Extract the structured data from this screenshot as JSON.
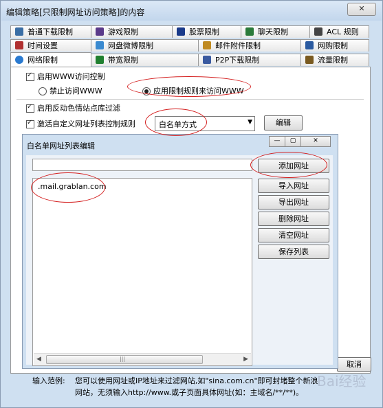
{
  "window": {
    "title": "编辑策略[只限制网址访问策略]的内容",
    "close_symbol": "✕"
  },
  "tabs_row1": [
    {
      "label": "普通下载限制",
      "icon": "download-clock-icon",
      "color": "#3a6ea5"
    },
    {
      "label": "游戏限制",
      "icon": "game-icon",
      "color": "#5a3a8a"
    },
    {
      "label": "股票限制",
      "icon": "stock-icon",
      "color": "#1a3a8a"
    },
    {
      "label": "聊天限制",
      "icon": "chat-icon",
      "color": "#2a7a3a"
    },
    {
      "label": "ACL 规则",
      "icon": "acl-icon",
      "color": "#444444"
    }
  ],
  "tabs_row2": [
    {
      "label": "时间设置",
      "icon": "clock-icon",
      "color": "#b03030"
    },
    {
      "label": "网盘微博限制",
      "icon": "cloud-icon",
      "color": "#3a8ad0"
    },
    {
      "label": "邮件附件限制",
      "icon": "mail-icon",
      "color": "#c08a20"
    },
    {
      "label": "网购限制",
      "icon": "cart-icon",
      "color": "#2a5aa0"
    }
  ],
  "tabs_row3": [
    {
      "label": "网络限制",
      "icon": "globe-icon",
      "color": "#2a7ad0"
    },
    {
      "label": "带宽限制",
      "icon": "bandwidth-icon",
      "color": "#208030"
    },
    {
      "label": "P2P下载限制",
      "icon": "p2p-icon",
      "color": "#3a5aa0"
    },
    {
      "label": "流量限制",
      "icon": "traffic-icon",
      "color": "#7a5a20"
    }
  ],
  "network": {
    "enable_www": "启用WWW访问控制",
    "radio_forbid": "禁止访问WWW",
    "radio_apply": "应用限制规则来访问WWW",
    "anti_porn": "启用反动色情站点库过滤",
    "custom_list": "激活自定义网址列表控制规则",
    "mode_value": "白名单方式",
    "edit_button": "编辑"
  },
  "dialog": {
    "title": "白名单网址列表编辑",
    "min_symbol": "—",
    "max_symbol": "▢",
    "close_symbol": "✕",
    "url_input": "",
    "list": [
      ".mail.grablan.com"
    ],
    "buttons": [
      "添加网址",
      "导入网址",
      "导出网址",
      "删除网址",
      "清空网址",
      "保存列表"
    ]
  },
  "footer": {
    "example_label": "输入范例:",
    "example_line1": "您可以使用网址或IP地址来过滤网站,如\"sina.com.cn\"即可封堵整个新浪",
    "example_line2": "网站，无须输入http://www.或子页面具体网址(如：主域名/**/**)。",
    "cancel_button": "取消"
  },
  "watermark": "Bai经验",
  "colors": {
    "annotation": "#d42020",
    "window_bg": "#cfe0f1"
  }
}
